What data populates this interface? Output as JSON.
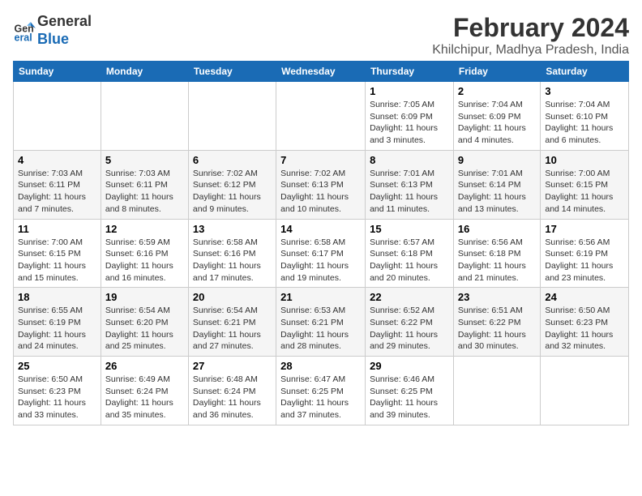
{
  "logo": {
    "line1": "General",
    "line2": "Blue"
  },
  "title": "February 2024",
  "subtitle": "Khilchipur, Madhya Pradesh, India",
  "days_of_week": [
    "Sunday",
    "Monday",
    "Tuesday",
    "Wednesday",
    "Thursday",
    "Friday",
    "Saturday"
  ],
  "weeks": [
    [
      {
        "day": "",
        "info": ""
      },
      {
        "day": "",
        "info": ""
      },
      {
        "day": "",
        "info": ""
      },
      {
        "day": "",
        "info": ""
      },
      {
        "day": "1",
        "info": "Sunrise: 7:05 AM\nSunset: 6:09 PM\nDaylight: 11 hours and 3 minutes."
      },
      {
        "day": "2",
        "info": "Sunrise: 7:04 AM\nSunset: 6:09 PM\nDaylight: 11 hours and 4 minutes."
      },
      {
        "day": "3",
        "info": "Sunrise: 7:04 AM\nSunset: 6:10 PM\nDaylight: 11 hours and 6 minutes."
      }
    ],
    [
      {
        "day": "4",
        "info": "Sunrise: 7:03 AM\nSunset: 6:11 PM\nDaylight: 11 hours and 7 minutes."
      },
      {
        "day": "5",
        "info": "Sunrise: 7:03 AM\nSunset: 6:11 PM\nDaylight: 11 hours and 8 minutes."
      },
      {
        "day": "6",
        "info": "Sunrise: 7:02 AM\nSunset: 6:12 PM\nDaylight: 11 hours and 9 minutes."
      },
      {
        "day": "7",
        "info": "Sunrise: 7:02 AM\nSunset: 6:13 PM\nDaylight: 11 hours and 10 minutes."
      },
      {
        "day": "8",
        "info": "Sunrise: 7:01 AM\nSunset: 6:13 PM\nDaylight: 11 hours and 11 minutes."
      },
      {
        "day": "9",
        "info": "Sunrise: 7:01 AM\nSunset: 6:14 PM\nDaylight: 11 hours and 13 minutes."
      },
      {
        "day": "10",
        "info": "Sunrise: 7:00 AM\nSunset: 6:15 PM\nDaylight: 11 hours and 14 minutes."
      }
    ],
    [
      {
        "day": "11",
        "info": "Sunrise: 7:00 AM\nSunset: 6:15 PM\nDaylight: 11 hours and 15 minutes."
      },
      {
        "day": "12",
        "info": "Sunrise: 6:59 AM\nSunset: 6:16 PM\nDaylight: 11 hours and 16 minutes."
      },
      {
        "day": "13",
        "info": "Sunrise: 6:58 AM\nSunset: 6:16 PM\nDaylight: 11 hours and 17 minutes."
      },
      {
        "day": "14",
        "info": "Sunrise: 6:58 AM\nSunset: 6:17 PM\nDaylight: 11 hours and 19 minutes."
      },
      {
        "day": "15",
        "info": "Sunrise: 6:57 AM\nSunset: 6:18 PM\nDaylight: 11 hours and 20 minutes."
      },
      {
        "day": "16",
        "info": "Sunrise: 6:56 AM\nSunset: 6:18 PM\nDaylight: 11 hours and 21 minutes."
      },
      {
        "day": "17",
        "info": "Sunrise: 6:56 AM\nSunset: 6:19 PM\nDaylight: 11 hours and 23 minutes."
      }
    ],
    [
      {
        "day": "18",
        "info": "Sunrise: 6:55 AM\nSunset: 6:19 PM\nDaylight: 11 hours and 24 minutes."
      },
      {
        "day": "19",
        "info": "Sunrise: 6:54 AM\nSunset: 6:20 PM\nDaylight: 11 hours and 25 minutes."
      },
      {
        "day": "20",
        "info": "Sunrise: 6:54 AM\nSunset: 6:21 PM\nDaylight: 11 hours and 27 minutes."
      },
      {
        "day": "21",
        "info": "Sunrise: 6:53 AM\nSunset: 6:21 PM\nDaylight: 11 hours and 28 minutes."
      },
      {
        "day": "22",
        "info": "Sunrise: 6:52 AM\nSunset: 6:22 PM\nDaylight: 11 hours and 29 minutes."
      },
      {
        "day": "23",
        "info": "Sunrise: 6:51 AM\nSunset: 6:22 PM\nDaylight: 11 hours and 30 minutes."
      },
      {
        "day": "24",
        "info": "Sunrise: 6:50 AM\nSunset: 6:23 PM\nDaylight: 11 hours and 32 minutes."
      }
    ],
    [
      {
        "day": "25",
        "info": "Sunrise: 6:50 AM\nSunset: 6:23 PM\nDaylight: 11 hours and 33 minutes."
      },
      {
        "day": "26",
        "info": "Sunrise: 6:49 AM\nSunset: 6:24 PM\nDaylight: 11 hours and 35 minutes."
      },
      {
        "day": "27",
        "info": "Sunrise: 6:48 AM\nSunset: 6:24 PM\nDaylight: 11 hours and 36 minutes."
      },
      {
        "day": "28",
        "info": "Sunrise: 6:47 AM\nSunset: 6:25 PM\nDaylight: 11 hours and 37 minutes."
      },
      {
        "day": "29",
        "info": "Sunrise: 6:46 AM\nSunset: 6:25 PM\nDaylight: 11 hours and 39 minutes."
      },
      {
        "day": "",
        "info": ""
      },
      {
        "day": "",
        "info": ""
      }
    ]
  ]
}
